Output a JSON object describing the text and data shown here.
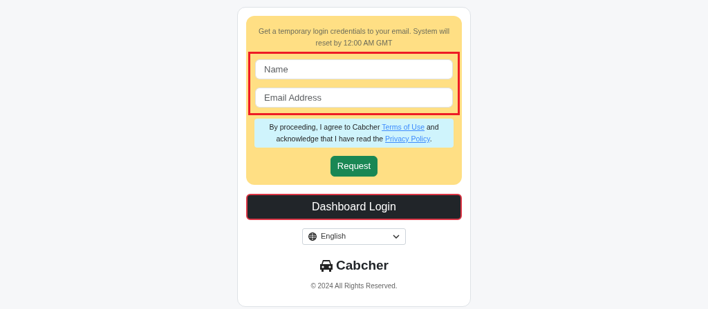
{
  "intro": "Get a temporary login credentials to your email. System will reset by 12:00 AM GMT",
  "fields": [
    {
      "placeholder": "Name"
    },
    {
      "placeholder": "Email Address"
    }
  ],
  "notice": [
    {
      "kind": "text",
      "text": "By proceeding, I agree to Cabcher "
    },
    {
      "kind": "link",
      "text": "Terms of Use"
    },
    {
      "kind": "text",
      "text": " and acknowledge that I have read the "
    },
    {
      "kind": "link",
      "text": "Privacy Policy"
    },
    {
      "kind": "text",
      "text": "."
    }
  ],
  "request_button": "Request",
  "dashboard_button": "Dashboard Login",
  "language": "English",
  "brand": "Cabcher",
  "copyright": "© 2024 All Rights Reserved."
}
